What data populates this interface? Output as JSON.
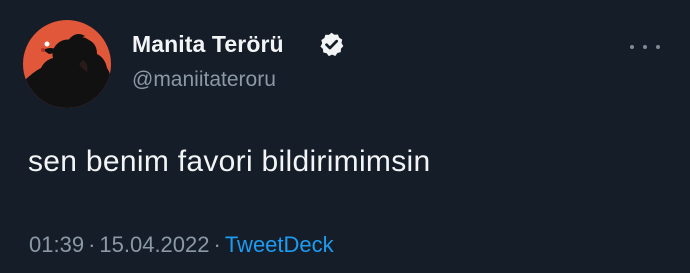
{
  "tweet": {
    "author": {
      "display_name": "Manita Terörü",
      "handle": "@maniitateroru",
      "verified": true,
      "avatar_icon": "anime-silhouette-avatar"
    },
    "text": "sen benim favori bildirimimsin",
    "time": "01:39",
    "date": "15.04.2022",
    "separator": "·",
    "source": "TweetDeck",
    "more_icon": "more-options-icon"
  },
  "colors": {
    "background": "#151d28",
    "primary_text": "#f2f4f5",
    "secondary_text": "#8b98a5",
    "link": "#1d9bf0",
    "avatar_bg": "#e0573a"
  }
}
